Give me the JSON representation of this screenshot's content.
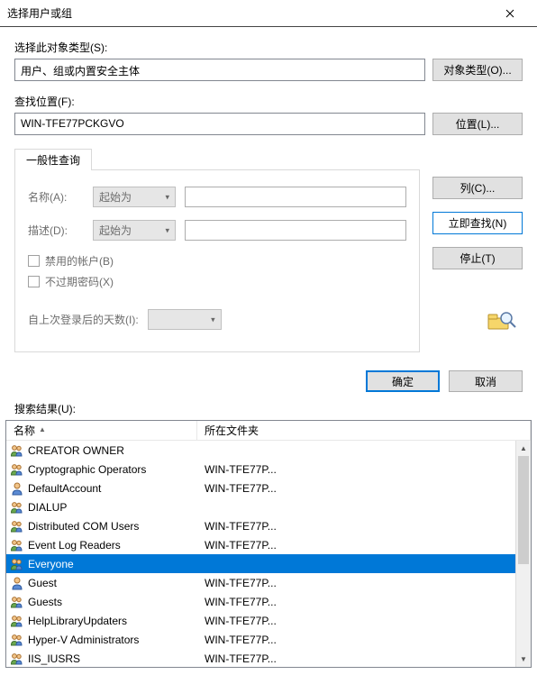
{
  "window": {
    "title": "选择用户或组"
  },
  "section1": {
    "label": "选择此对象类型(S):",
    "value": "用户、组或内置安全主体",
    "button": "对象类型(O)..."
  },
  "section2": {
    "label": "查找位置(F):",
    "value": "WIN-TFE77PCKGVO",
    "button": "位置(L)..."
  },
  "tab": {
    "label": "一般性查询",
    "name_label": "名称(A):",
    "name_mode": "起始为",
    "desc_label": "描述(D):",
    "desc_mode": "起始为",
    "chk_disabled": "禁用的帐户(B)",
    "chk_noexpire": "不过期密码(X)",
    "days_label": "自上次登录后的天数(I):"
  },
  "side": {
    "columns": "列(C)...",
    "findnow": "立即查找(N)",
    "stop": "停止(T)"
  },
  "dlg": {
    "ok": "确定",
    "cancel": "取消"
  },
  "results": {
    "label": "搜索结果(U):",
    "col_name": "名称",
    "col_folder": "所在文件夹",
    "rows": [
      {
        "icon": "group",
        "name": "CREATOR OWNER",
        "folder": ""
      },
      {
        "icon": "group",
        "name": "Cryptographic Operators",
        "folder": "WIN-TFE77P..."
      },
      {
        "icon": "user",
        "name": "DefaultAccount",
        "folder": "WIN-TFE77P..."
      },
      {
        "icon": "group",
        "name": "DIALUP",
        "folder": ""
      },
      {
        "icon": "group",
        "name": "Distributed COM Users",
        "folder": "WIN-TFE77P..."
      },
      {
        "icon": "group",
        "name": "Event Log Readers",
        "folder": "WIN-TFE77P..."
      },
      {
        "icon": "group",
        "name": "Everyone",
        "folder": "",
        "selected": true
      },
      {
        "icon": "user",
        "name": "Guest",
        "folder": "WIN-TFE77P..."
      },
      {
        "icon": "group",
        "name": "Guests",
        "folder": "WIN-TFE77P..."
      },
      {
        "icon": "group",
        "name": "HelpLibraryUpdaters",
        "folder": "WIN-TFE77P..."
      },
      {
        "icon": "group",
        "name": "Hyper-V Administrators",
        "folder": "WIN-TFE77P..."
      },
      {
        "icon": "group",
        "name": "IIS_IUSRS",
        "folder": "WIN-TFE77P..."
      }
    ]
  }
}
